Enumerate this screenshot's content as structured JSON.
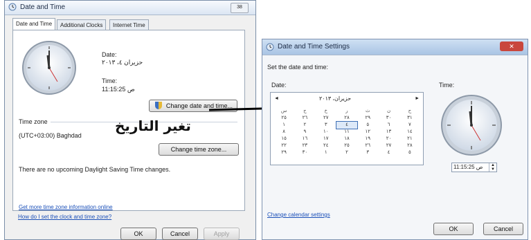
{
  "dialog1": {
    "title": "Date and Time",
    "close_label": "38",
    "tabs": [
      "Date and Time",
      "Additional Clocks",
      "Internet Time"
    ],
    "date_label": "Date:",
    "date_value": "حزيران ٤، ٢٠١٣",
    "time_label": "Time:",
    "time_value": "11:15:25 ص",
    "change_date_button": "Change date and time...",
    "timezone_label": "Time zone",
    "timezone_value": "(UTC+03:00) Baghdad",
    "change_timezone_button": "Change time zone...",
    "dst_text": "There are no upcoming Daylight Saving Time changes.",
    "link_timezone_info": "Get more time zone information online",
    "link_set_clock": "How do I set the clock and time zone?",
    "ok": "OK",
    "cancel": "Cancel",
    "apply": "Apply"
  },
  "annotation": {
    "text": "تغير التاريخ",
    "arrow_color": "#000000"
  },
  "dialog2": {
    "title": "Date and Time Settings",
    "instruction": "Set the date and time:",
    "date_label": "Date:",
    "time_label": "Time:",
    "calendar_header": "حزيران، ٢٠١٣",
    "prev_icon": "◄",
    "next_icon": "►",
    "weekdays": [
      "س",
      "ج",
      "خ",
      "ر",
      "ث",
      "ن",
      "ح"
    ],
    "weeks": [
      [
        "٢٥",
        "٢٦",
        "٢٧",
        "٢٨",
        "٢٩",
        "٣٠",
        "٣١"
      ],
      [
        "١",
        "٢",
        "٣",
        "٤",
        "٥",
        "٦",
        "٧"
      ],
      [
        "٨",
        "٩",
        "١٠",
        "١١",
        "١٢",
        "١٣",
        "١٤"
      ],
      [
        "١٥",
        "١٦",
        "١٧",
        "١٨",
        "١٩",
        "٢٠",
        "٢١"
      ],
      [
        "٢٢",
        "٢٣",
        "٢٤",
        "٢٥",
        "٢٦",
        "٢٧",
        "٢٨"
      ],
      [
        "٢٩",
        "٣٠",
        "١",
        "٢",
        "٣",
        "٤",
        "٥"
      ]
    ],
    "time_value": "11:15:25 ص",
    "link_calendar": "Change calendar settings",
    "ok": "OK",
    "cancel": "Cancel",
    "close_color": "#c9473d"
  }
}
